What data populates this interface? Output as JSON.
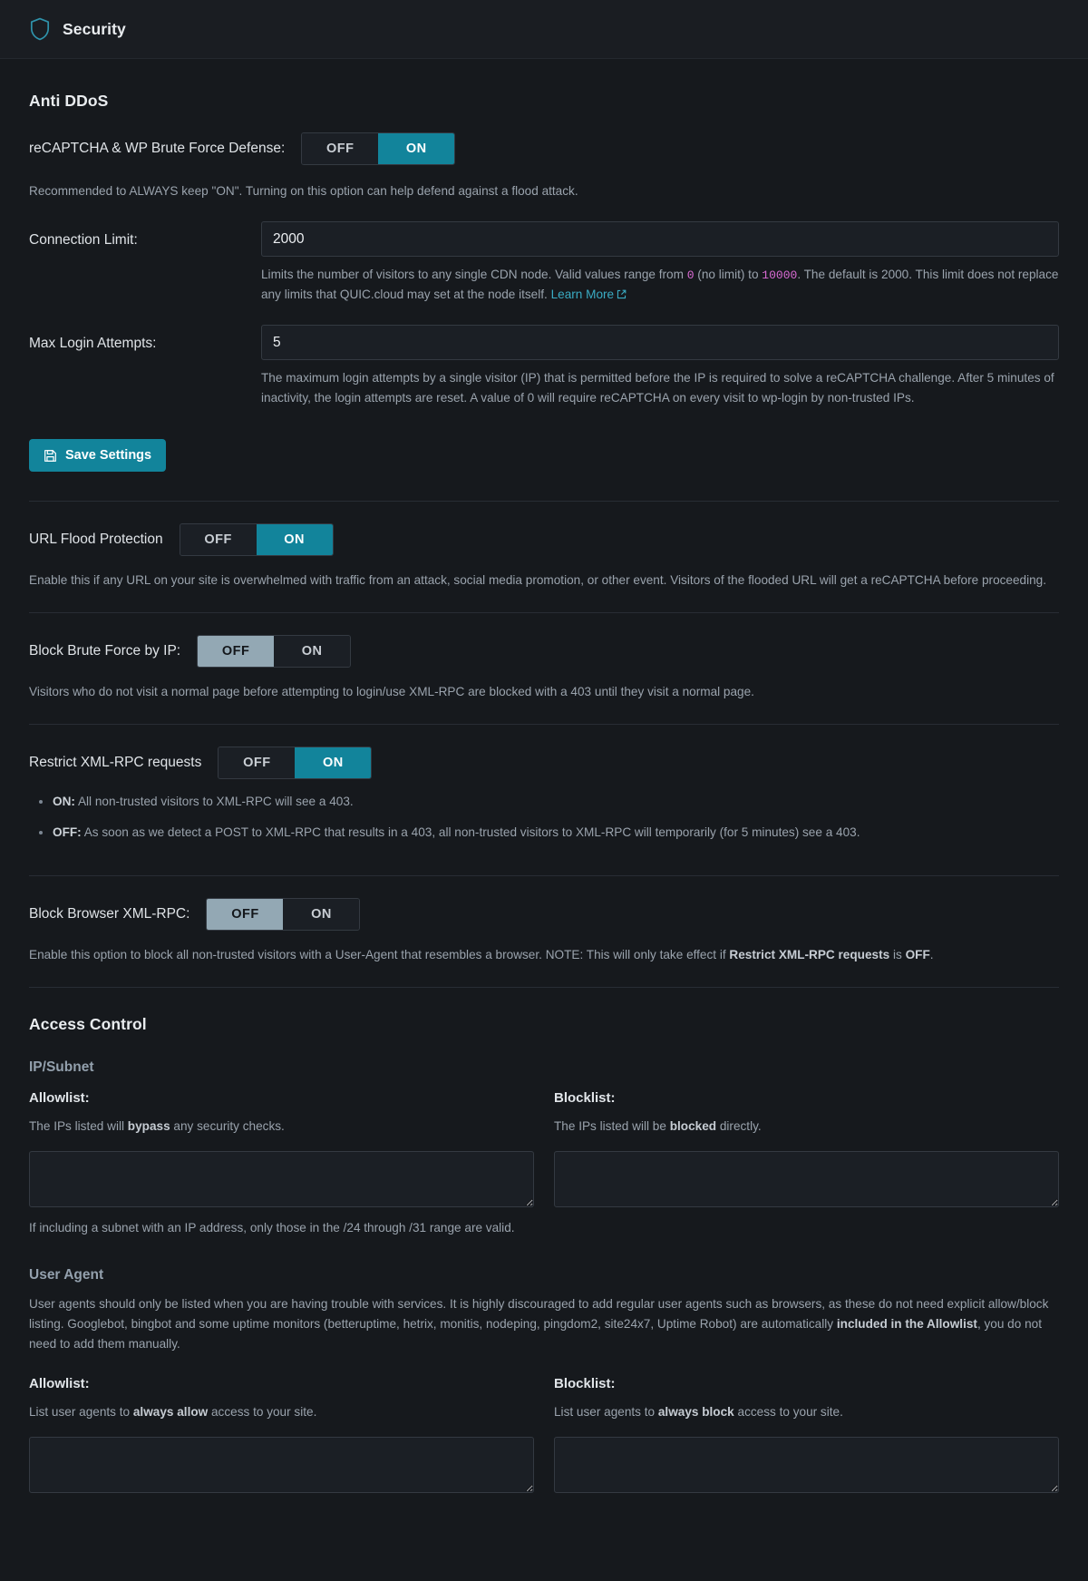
{
  "header": {
    "title": "Security",
    "icon": "shield-icon"
  },
  "colors": {
    "accent": "#12849b",
    "link": "#3aacc4",
    "mono_value": "#d96bd4",
    "off_active": "#93a8b4",
    "page_bg": "#16191d",
    "panel_bg": "#1b1f25"
  },
  "anti_ddos": {
    "heading": "Anti DDoS",
    "recaptcha": {
      "label": "reCAPTCHA & WP Brute Force Defense:",
      "off_label": "OFF",
      "on_label": "ON",
      "value": "ON",
      "helper": "Recommended to ALWAYS keep \"ON\". Turning on this option can help defend against a flood attack."
    },
    "connection_limit": {
      "label": "Connection Limit:",
      "value": "2000",
      "placeholder": "",
      "helper_1": "Limits the number of visitors to any single CDN node. Valid values range from ",
      "min": "0",
      "helper_2": " (no limit) to ",
      "max": "10000",
      "helper_3": ". The default is 2000. This limit does not replace any limits that QUIC.cloud may set at the node itself. ",
      "link_label": "Learn More"
    },
    "max_login_attempts": {
      "label": "Max Login Attempts:",
      "value": "5",
      "placeholder": "",
      "helper": "The maximum login attempts by a single visitor (IP) that is permitted before the IP is required to solve a reCAPTCHA challenge. After 5 minutes of inactivity, the login attempts are reset. A value of 0 will require reCAPTCHA on every visit to wp-login by non-trusted IPs."
    },
    "save_button": {
      "label": "Save Settings",
      "icon": "save-icon"
    },
    "url_flood": {
      "label": "URL Flood Protection",
      "off_label": "OFF",
      "on_label": "ON",
      "value": "ON",
      "helper": "Enable this if any URL on your site is overwhelmed with traffic from an attack, social media promotion, or other event. Visitors of the flooded URL will get a reCAPTCHA before proceeding."
    },
    "block_brute_force": {
      "label": "Block Brute Force by IP:",
      "off_label": "OFF",
      "on_label": "ON",
      "value": "OFF",
      "helper": "Visitors who do not visit a normal page before attempting to login/use XML-RPC are blocked with a 403 until they visit a normal page."
    },
    "restrict_xmlrpc": {
      "label": "Restrict XML-RPC requests",
      "off_label": "OFF",
      "on_label": "ON",
      "value": "ON",
      "bullets": [
        {
          "term": "ON:",
          "text": " All non-trusted visitors to XML-RPC will see a 403."
        },
        {
          "term": "OFF:",
          "text": " As soon as we detect a POST to XML-RPC that results in a 403, all non-trusted visitors to XML-RPC will temporarily (for 5 minutes) see a 403."
        }
      ]
    },
    "block_browser_xmlrpc": {
      "label": "Block Browser XML-RPC:",
      "off_label": "OFF",
      "on_label": "ON",
      "value": "OFF",
      "helper_1": "Enable this option to block all non-trusted visitors with a User-Agent that resembles a browser. NOTE: This will only take effect if ",
      "helper_bold": "Restrict XML-RPC requests",
      "helper_2": " is ",
      "helper_bold_2": "OFF",
      "helper_3": "."
    }
  },
  "access_control": {
    "heading": "Access Control",
    "ip_subnet": {
      "heading": "IP/Subnet",
      "allowlist": {
        "label": "Allowlist:",
        "helper_1": "The IPs listed will ",
        "helper_bold": "bypass",
        "helper_2": " any security checks.",
        "value": "",
        "placeholder": ""
      },
      "blocklist": {
        "label": "Blocklist:",
        "helper_1": "The IPs listed will be ",
        "helper_bold": "blocked",
        "helper_2": " directly.",
        "value": "",
        "placeholder": ""
      },
      "note": "If including a subnet with an IP address, only those in the /24 through /31 range are valid."
    },
    "user_agent": {
      "heading": "User Agent",
      "helper_1": "User agents should only be listed when you are having trouble with services. It is highly discouraged to add regular user agents such as browsers, as these do not need explicit allow/block listing. Googlebot, bingbot and some uptime monitors (betteruptime, hetrix, monitis, nodeping, pingdom2, site24x7, Uptime Robot) are automatically ",
      "helper_bold": "included in the Allowlist",
      "helper_2": ", you do not need to add them manually.",
      "allowlist": {
        "label": "Allowlist:",
        "helper_1": "List user agents to ",
        "helper_bold": "always allow",
        "helper_2": " access to your site.",
        "value": "",
        "placeholder": ""
      },
      "blocklist": {
        "label": "Blocklist:",
        "helper_1": "List user agents to ",
        "helper_bold": "always block",
        "helper_2": " access to your site.",
        "value": "",
        "placeholder": ""
      }
    }
  }
}
